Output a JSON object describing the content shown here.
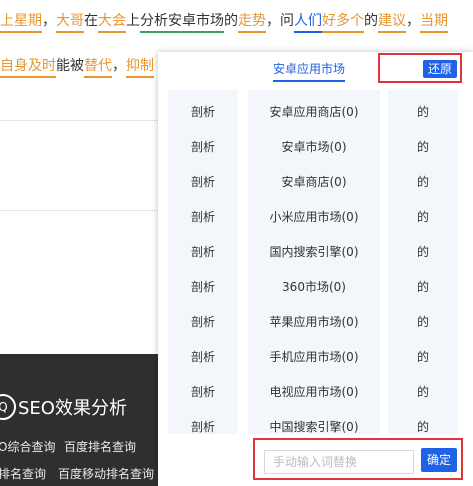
{
  "article": {
    "line1": [
      {
        "t": "上星期",
        "s": "orange"
      },
      {
        "t": "，",
        "s": "plain"
      },
      {
        "t": "大哥",
        "s": "orange"
      },
      {
        "t": "在",
        "s": "plain"
      },
      {
        "t": "大会",
        "s": "orange"
      },
      {
        "t": "上",
        "s": "plain"
      },
      {
        "t": "分析",
        "s": "green"
      },
      {
        "t": "安卓市场",
        "s": "green"
      },
      {
        "t": "的",
        "s": "plain"
      },
      {
        "t": "走势",
        "s": "orange"
      },
      {
        "t": "，问",
        "s": "plain"
      },
      {
        "t": "人们",
        "s": "blue"
      },
      {
        "t": "好多个",
        "s": "orange"
      },
      {
        "t": "的",
        "s": "plain"
      },
      {
        "t": "建议",
        "s": "orange"
      },
      {
        "t": "，",
        "s": "plain"
      },
      {
        "t": "当期",
        "s": "orange"
      }
    ],
    "line2": [
      {
        "t": "自身",
        "s": "orange"
      },
      {
        "t": "及时",
        "s": "orange"
      },
      {
        "t": "能被",
        "s": "plain"
      },
      {
        "t": "替代",
        "s": "orange"
      },
      {
        "t": "，",
        "s": "plain"
      },
      {
        "t": "抑制",
        "s": "orange"
      }
    ]
  },
  "footer": {
    "icon": "Q",
    "title": "SEO效果分析",
    "links": [
      "O综合查询",
      "百度排名查询",
      "排名查询",
      "百度移动排名查询"
    ]
  },
  "popup": {
    "tab_label": "安卓应用市场",
    "restore_label": "还原",
    "rows": [
      {
        "a": "剖析",
        "b": "安卓应用商店(0)",
        "c": "的"
      },
      {
        "a": "剖析",
        "b": "安卓市场(0)",
        "c": "的"
      },
      {
        "a": "剖析",
        "b": "安卓商店(0)",
        "c": "的"
      },
      {
        "a": "剖析",
        "b": "小米应用市场(0)",
        "c": "的"
      },
      {
        "a": "剖析",
        "b": "国内搜索引擎(0)",
        "c": "的"
      },
      {
        "a": "剖析",
        "b": "360市场(0)",
        "c": "的"
      },
      {
        "a": "剖析",
        "b": "苹果应用市场(0)",
        "c": "的"
      },
      {
        "a": "剖析",
        "b": "手机应用市场(0)",
        "c": "的"
      },
      {
        "a": "剖析",
        "b": "电视应用市场(0)",
        "c": "的"
      },
      {
        "a": "剖析",
        "b": "中国搜索引擎(0)",
        "c": "的"
      }
    ],
    "input_placeholder": "手动输入词替换",
    "confirm_label": "确定"
  }
}
